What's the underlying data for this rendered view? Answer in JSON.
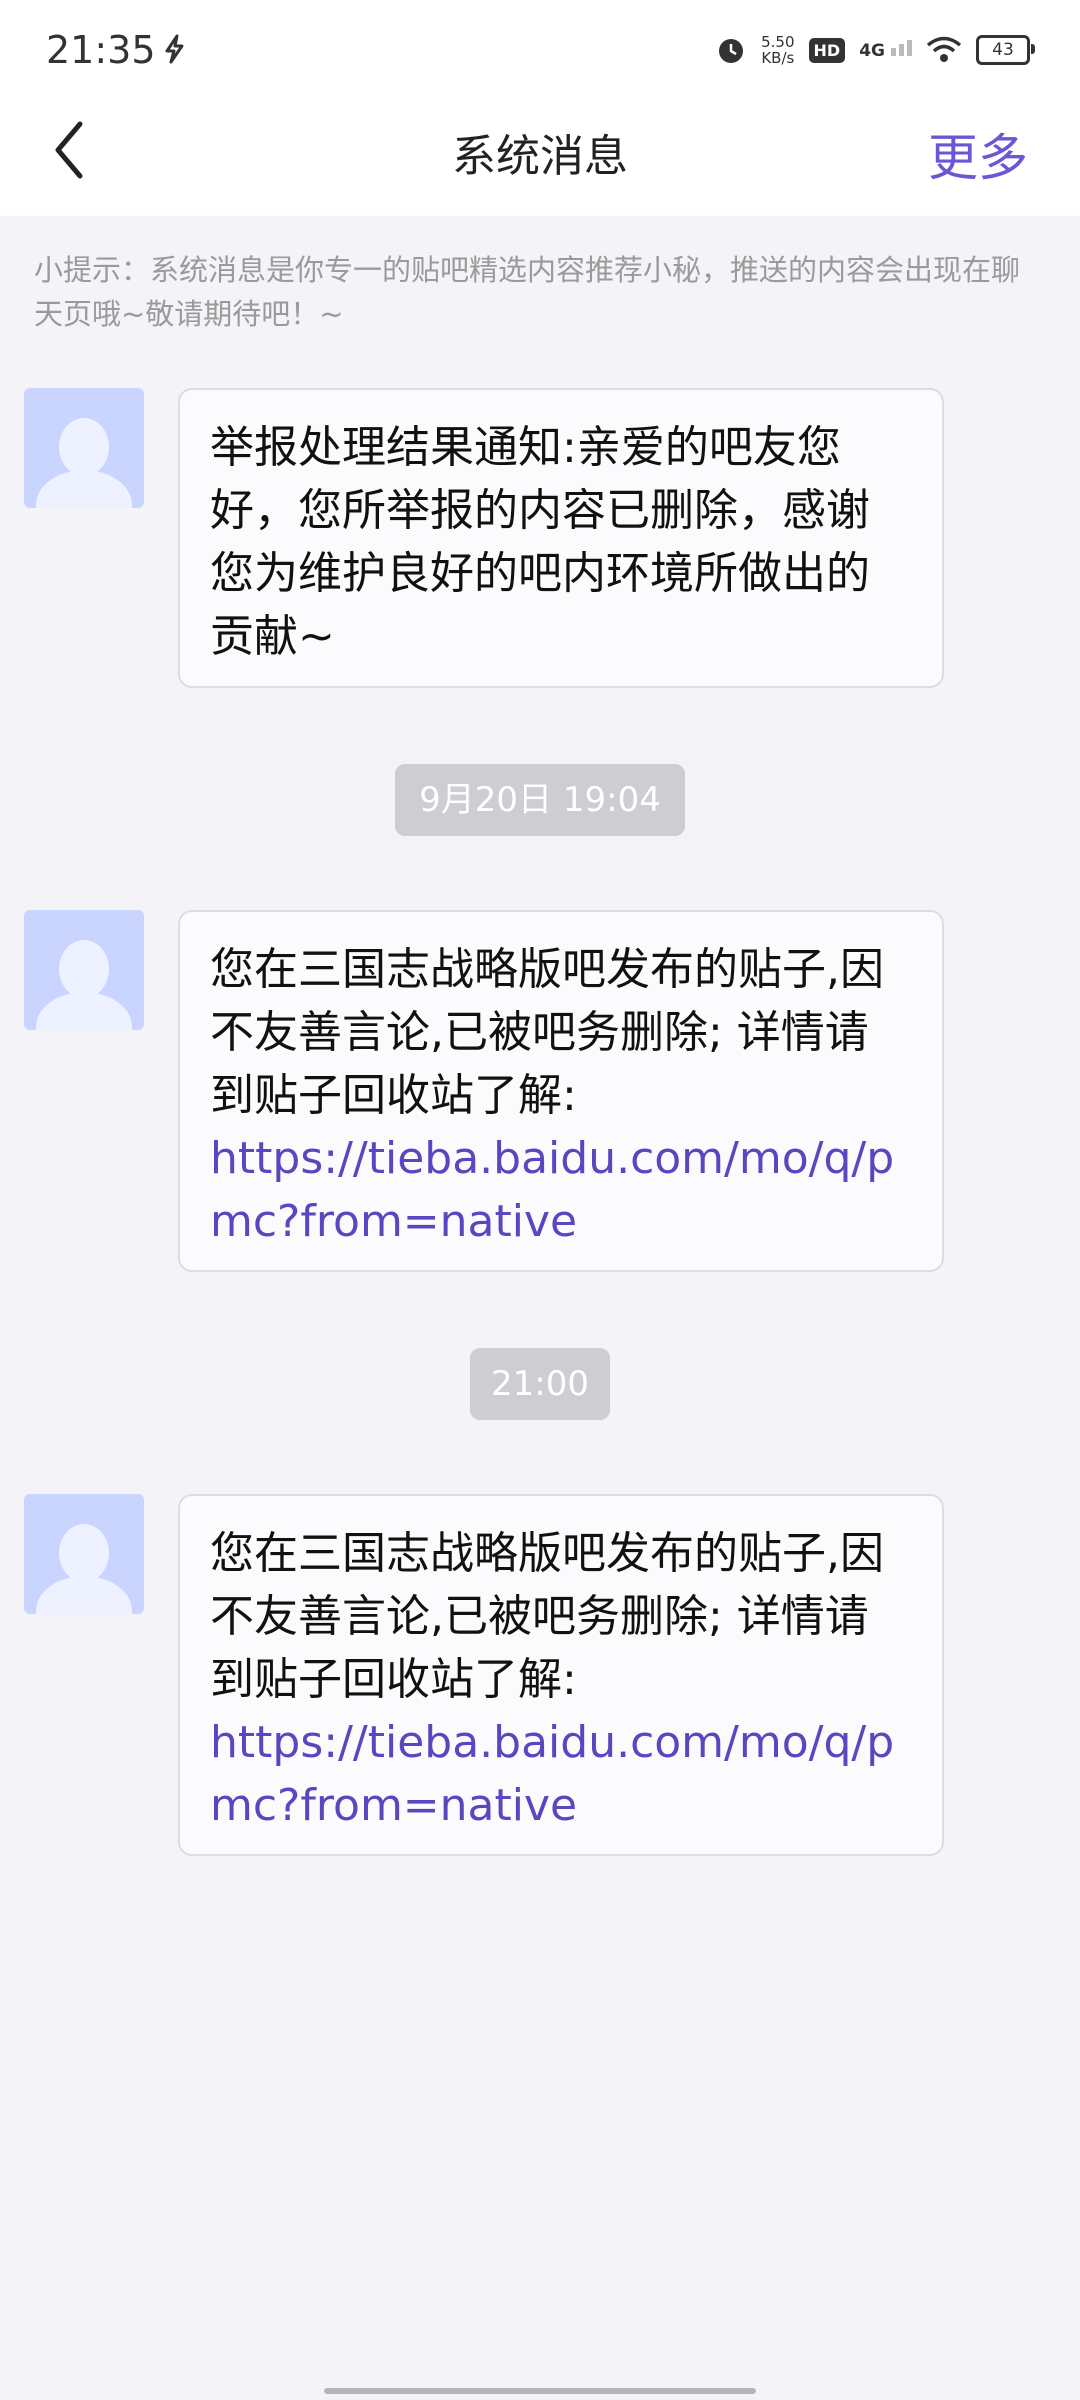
{
  "status_bar": {
    "time": "21:35",
    "speed_value": "5.50",
    "speed_unit": "KB/s",
    "hd": "HD",
    "network": "4G",
    "battery": "43"
  },
  "header": {
    "title": "系统消息",
    "more_label": "更多"
  },
  "tip": "小提示：系统消息是你专一的贴吧精选内容推荐小秘，推送的内容会出现在聊天页哦~敬请期待吧！~",
  "messages": [
    {
      "text": "举报处理结果通知:亲爱的吧友您好，您所举报的内容已删除，感谢您为维护良好的吧内环境所做出的贡献~"
    },
    {
      "timestamp": "9月20日 19:04",
      "text": "您在三国志战略版吧发布的贴子,因不友善言论,已被吧务删除; 详情请到贴子回收站了解:",
      "link": "https://tieba.baidu.com/mo/q/pmc?from=native"
    },
    {
      "timestamp": "21:00",
      "text": "您在三国志战略版吧发布的贴子,因不友善言论,已被吧务删除; 详情请到贴子回收站了解:",
      "link": "https://tieba.baidu.com/mo/q/pmc?from=native"
    }
  ],
  "colors": {
    "accent": "#6b56d6",
    "link": "#5b46c2",
    "background": "#f4f4f8"
  }
}
